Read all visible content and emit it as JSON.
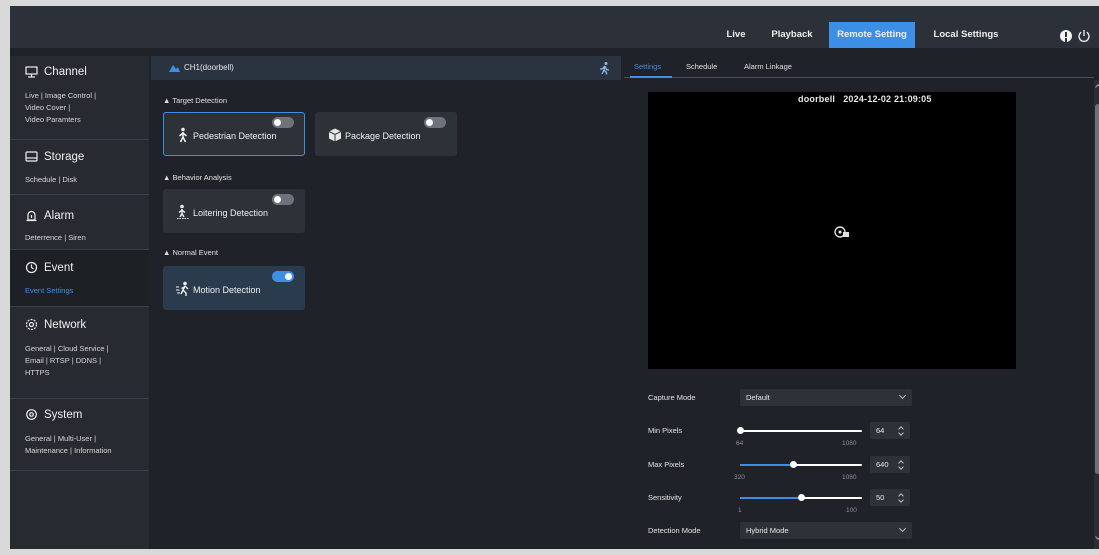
{
  "nav": {
    "items": [
      {
        "label": "Live",
        "active": false
      },
      {
        "label": "Playback",
        "active": false
      },
      {
        "label": "Remote Setting",
        "active": true
      },
      {
        "label": "Local Settings",
        "active": false
      }
    ]
  },
  "sidebar": {
    "sections": [
      {
        "title": "Channel",
        "icon": "channel-icon",
        "links": [
          "Live",
          "Image Control",
          "Video Cover",
          "Video Paramters"
        ]
      },
      {
        "title": "Storage",
        "icon": "storage-icon",
        "links": [
          "Schedule",
          "Disk"
        ]
      },
      {
        "title": "Alarm",
        "icon": "alarm-icon",
        "links": [
          "Deterrence",
          "Siren"
        ]
      },
      {
        "title": "Event",
        "icon": "event-icon",
        "links": [
          "Event Settings"
        ]
      },
      {
        "title": "Network",
        "icon": "network-icon",
        "links": [
          "General",
          "Cloud Service",
          "Email",
          "RTSP",
          "DDNS",
          "HTTPS"
        ]
      },
      {
        "title": "System",
        "icon": "system-icon",
        "links": [
          "General",
          "Multi-User",
          "Maintenance",
          "Information"
        ]
      }
    ]
  },
  "channel": {
    "label": "CH1(doorbell)"
  },
  "groups": {
    "target": "Target Detection",
    "behavior": "Behavior Analysis",
    "normal": "Normal Event"
  },
  "cards": {
    "pedestrian": {
      "label": "Pedestrian Detection",
      "enabled": false
    },
    "package": {
      "label": "Package Detection",
      "enabled": false
    },
    "loitering": {
      "label": "Loitering Detection",
      "enabled": false
    },
    "motion": {
      "label": "Motion Detection",
      "enabled": true
    }
  },
  "tabs": [
    "Settings",
    "Schedule",
    "Alarm Linkage"
  ],
  "video": {
    "osd_name": "doorbell",
    "osd_time": "2024-12-02 21:09:05"
  },
  "form": {
    "capture_mode": {
      "label": "Capture Mode",
      "value": "Default"
    },
    "min_pixels": {
      "label": "Min Pixels",
      "value": "64",
      "min": "64",
      "max": "1080"
    },
    "max_pixels": {
      "label": "Max Pixels",
      "value": "640",
      "min": "320",
      "max": "1080"
    },
    "sensitivity": {
      "label": "Sensitivity",
      "value": "50",
      "min": "1",
      "max": "100"
    },
    "detection_mode": {
      "label": "Detection Mode",
      "value": "Hybrid Mode"
    }
  },
  "colors": {
    "accent": "#3d8ee6",
    "panel": "#1f2329",
    "topbar": "#2c3038"
  }
}
